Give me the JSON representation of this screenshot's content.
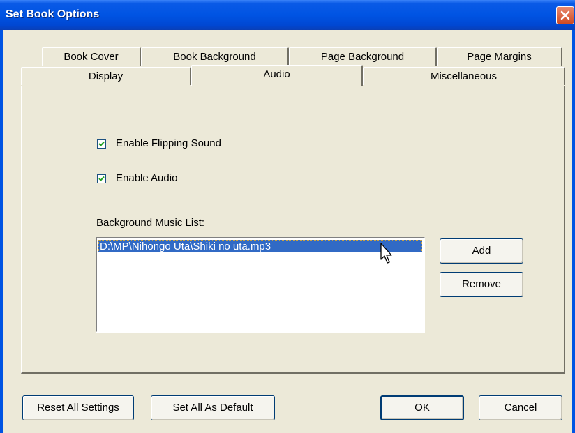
{
  "window": {
    "title": "Set Book Options"
  },
  "tabs": {
    "row1": [
      "Book Cover",
      "Book Background",
      "Page Background",
      "Page Margins"
    ],
    "row2": [
      "Display",
      "Audio",
      "Miscellaneous"
    ],
    "active": "Audio"
  },
  "audio": {
    "flip_sound": {
      "label": "Enable Flipping Sound",
      "checked": true
    },
    "enable_audio": {
      "label": "Enable Audio",
      "checked": true
    },
    "music_list_label": "Background Music List:",
    "music_list": [
      "D:\\MP\\Nihongo Uta\\Shiki no uta.mp3"
    ],
    "selected_index": 0,
    "add_label": "Add",
    "remove_label": "Remove"
  },
  "footer": {
    "reset_label": "Reset All Settings",
    "default_label": "Set All As Default",
    "ok_label": "OK",
    "cancel_label": "Cancel"
  },
  "colors": {
    "titlebar": "#0054e3",
    "selection": "#316ac5",
    "dialog_bg": "#ece9d8"
  }
}
